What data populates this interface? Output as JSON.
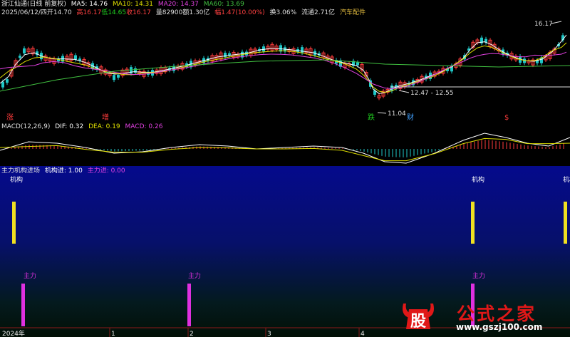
{
  "price_header": {
    "title": "浙江仙通(日线 前复权)",
    "ma5": "MA5: 14.76",
    "ma10": "MA10: 14.31",
    "ma20": "MA20: 14.37",
    "ma60": "MA60: 13.69",
    "date": "2025/06/12/四",
    "open": "开14.70",
    "high": "高16.17",
    "low": "低14.65",
    "close": "收16.17",
    "volume": "量82900",
    "amount": "额1.30亿",
    "change": "幅1.47(10.00%)",
    "turnover": "换3.06%",
    "float": "流通2.71亿",
    "sector": "汽车配件"
  },
  "price_chart": {
    "high_label": "16.17",
    "range_label": "12.47 - 12.55",
    "low_label": "11.04",
    "tags": [
      "涨",
      "增",
      "跌",
      "财",
      "$"
    ]
  },
  "macd_header": {
    "name": "MACD(12,26,9)",
    "dif": "DIF: 0.32",
    "dea": "DEA: 0.19",
    "macd": "MACD: 0.26"
  },
  "indicator_header": {
    "name": "主力机构进场",
    "jigou": "机构进: 1.00",
    "zhuli": "主力进: 0.00"
  },
  "indicator_chart": {
    "jigou_label": "机构",
    "zhuli_label": "主力",
    "jigou_signals": [
      1,
      1,
      1
    ],
    "zhuli_signals": [
      1,
      1,
      1
    ]
  },
  "x_axis": {
    "labels": [
      "2024年",
      "1",
      "2",
      "3",
      "4"
    ]
  },
  "watermark": {
    "logo_char": "股",
    "brand": "公式之家",
    "url": "www.gszj100.com"
  },
  "colors": {
    "up": "#ff3c3c",
    "down": "#20c8c8",
    "ma5": "#ffffff",
    "ma10": "#e0e000",
    "ma20": "#e040e0",
    "ma60": "#40c040",
    "jigou": "#f0e020",
    "zhuli": "#e030e0"
  }
}
